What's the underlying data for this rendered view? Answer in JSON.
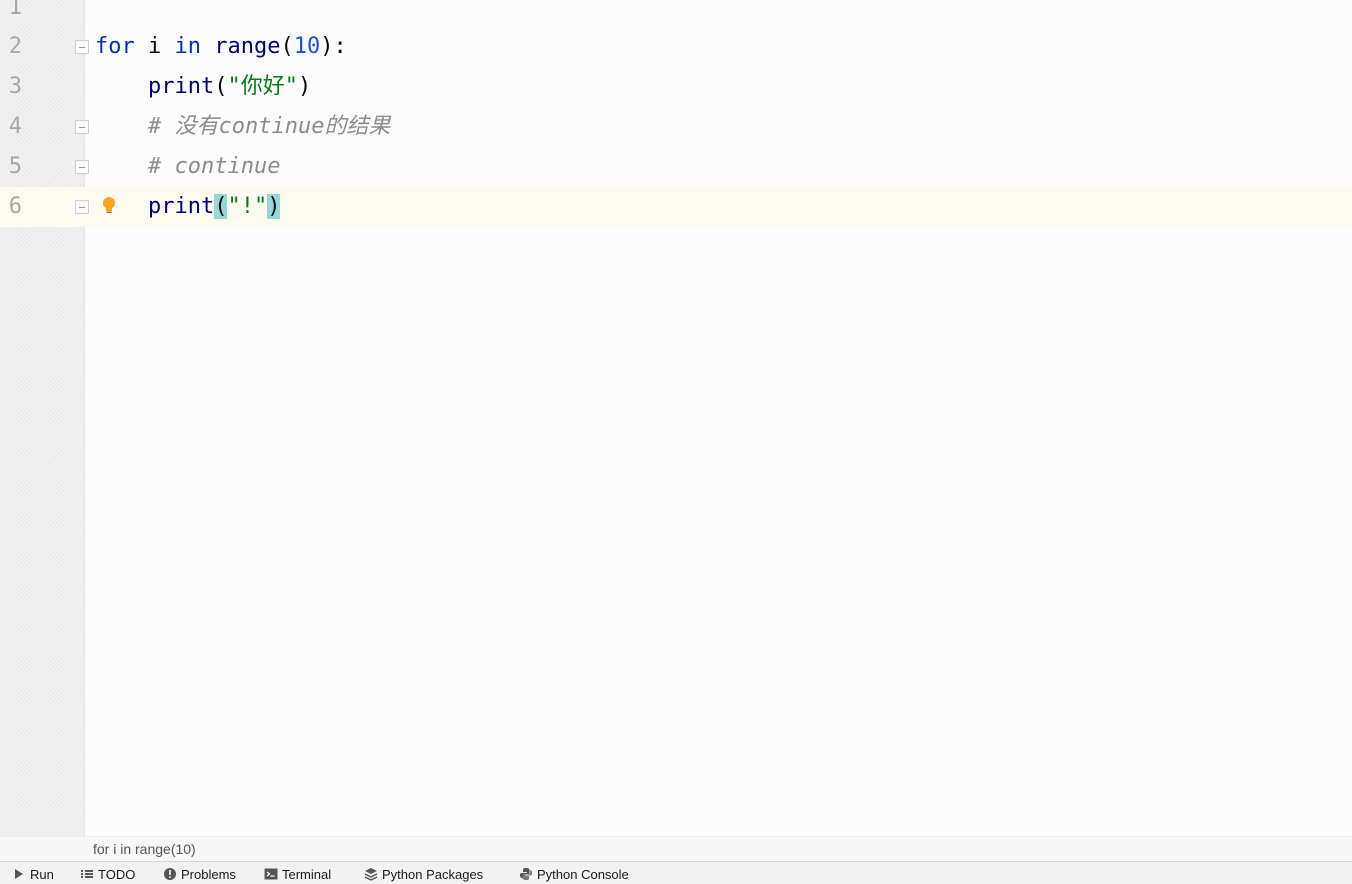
{
  "editor": {
    "lines": [
      {
        "number": "1",
        "tokens": []
      },
      {
        "number": "2",
        "tokens": [
          {
            "text": "for",
            "cls": "kw"
          },
          {
            "text": " i ",
            "cls": ""
          },
          {
            "text": "in",
            "cls": "kw"
          },
          {
            "text": " ",
            "cls": ""
          },
          {
            "text": "range",
            "cls": "fn"
          },
          {
            "text": "(",
            "cls": ""
          },
          {
            "text": "10",
            "cls": "num"
          },
          {
            "text": "):",
            "cls": ""
          }
        ]
      },
      {
        "number": "3",
        "tokens": [
          {
            "text": "    ",
            "cls": ""
          },
          {
            "text": "print",
            "cls": "fn"
          },
          {
            "text": "(",
            "cls": ""
          },
          {
            "text": "\"你好\"",
            "cls": "str"
          },
          {
            "text": ")",
            "cls": ""
          }
        ]
      },
      {
        "number": "4",
        "tokens": [
          {
            "text": "    ",
            "cls": ""
          },
          {
            "text": "# 没有continue的结果",
            "cls": "cm"
          }
        ]
      },
      {
        "number": "5",
        "tokens": [
          {
            "text": "    ",
            "cls": ""
          },
          {
            "text": "# continue",
            "cls": "cm"
          }
        ]
      },
      {
        "number": "6",
        "tokens": [
          {
            "text": "    ",
            "cls": ""
          },
          {
            "text": "print",
            "cls": "fn"
          },
          {
            "text": "(",
            "cls": "brace-hl"
          },
          {
            "text": "\"!\"",
            "cls": "str"
          },
          {
            "text": ")",
            "cls": "brace-hl"
          }
        ]
      }
    ],
    "current_line": "6",
    "fold_marker_lines": [
      "2",
      "4",
      "5",
      "6"
    ],
    "intention_bulb_line": "6"
  },
  "breadcrumb": {
    "text": "for i in range(10)"
  },
  "tool_windows": [
    {
      "label": "Run",
      "icon": "run-icon"
    },
    {
      "label": "TODO",
      "icon": "todo-icon"
    },
    {
      "label": "Problems",
      "icon": "problems-icon"
    },
    {
      "label": "Terminal",
      "icon": "terminal-icon"
    },
    {
      "label": "Python Packages",
      "icon": "packages-icon"
    },
    {
      "label": "Python Console",
      "icon": "python-console-icon"
    }
  ],
  "colors": {
    "keyword": "#0033b3",
    "function": "#000080",
    "number": "#1750eb",
    "string": "#067d17",
    "comment": "#8c8c8c",
    "brace_highlight": "#93d9d9",
    "current_line": "#fdfaf0",
    "bulb": "#f5a623"
  }
}
